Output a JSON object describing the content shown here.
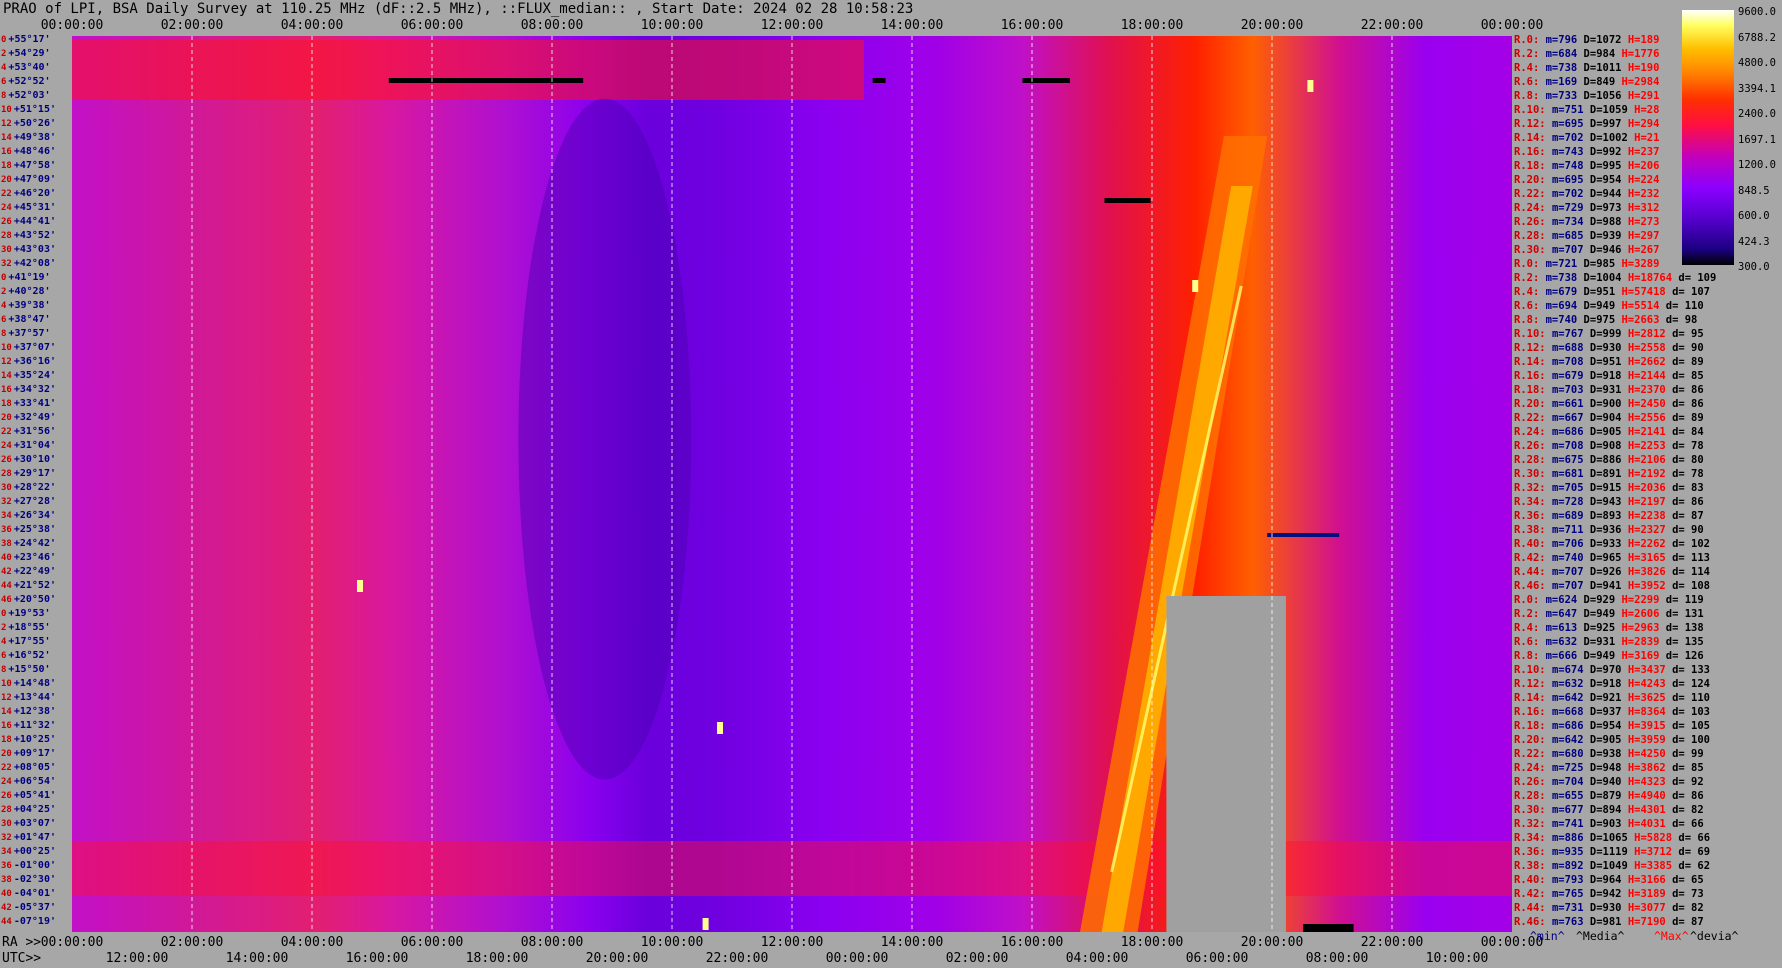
{
  "title": "PRAO of LPI, BSA Daily Survey at 110.25 MHz (dF::2.5 MHz), ::FLUX_median:: , Start Date: 2024 02 28 10:58:23",
  "chart_data": {
    "type": "heatmap",
    "title": "PRAO of LPI, BSA Daily Survey at 110.25 MHz (dF::2.5 MHz), ::FLUX_median:: , Start Date: 2024 02 28 10:58:23",
    "x_top_ticks": [
      "00:00:00",
      "02:00:00",
      "04:00:00",
      "06:00:00",
      "08:00:00",
      "10:00:00",
      "12:00:00",
      "14:00:00",
      "16:00:00",
      "18:00:00",
      "20:00:00",
      "22:00:00",
      "00:00:00"
    ],
    "x_bottom_label_ra": "RA >>",
    "x_bottom_label_utc": "UTC>>",
    "ra_ticks": [
      "00:00:00",
      "02:00:00",
      "04:00:00",
      "06:00:00",
      "08:00:00",
      "10:00:00",
      "12:00:00",
      "14:00:00",
      "16:00:00",
      "18:00:00",
      "20:00:00",
      "22:00:00",
      "00:00:00"
    ],
    "utc_ticks": [
      "12:00:00",
      "14:00:00",
      "16:00:00",
      "18:00:00",
      "20:00:00",
      "22:00:00",
      "00:00:00",
      "02:00:00",
      "04:00:00",
      "06:00:00",
      "08:00:00",
      "10:00:00"
    ],
    "y_rows": [
      {
        "n": "0",
        "dec": "+55°17'"
      },
      {
        "n": "2",
        "dec": "+54°29'"
      },
      {
        "n": "4",
        "dec": "+53°40'"
      },
      {
        "n": "6",
        "dec": "+52°52'"
      },
      {
        "n": "8",
        "dec": "+52°03'"
      },
      {
        "n": "10",
        "dec": "+51°15'"
      },
      {
        "n": "12",
        "dec": "+50°26'"
      },
      {
        "n": "14",
        "dec": "+49°38'"
      },
      {
        "n": "16",
        "dec": "+48°46'"
      },
      {
        "n": "18",
        "dec": "+47°58'"
      },
      {
        "n": "20",
        "dec": "+47°09'"
      },
      {
        "n": "22",
        "dec": "+46°20'"
      },
      {
        "n": "24",
        "dec": "+45°31'"
      },
      {
        "n": "26",
        "dec": "+44°41'"
      },
      {
        "n": "28",
        "dec": "+43°52'"
      },
      {
        "n": "30",
        "dec": "+43°03'"
      },
      {
        "n": "32",
        "dec": "+42°08'"
      },
      {
        "n": "0",
        "dec": "+41°19'"
      },
      {
        "n": "2",
        "dec": "+40°28'"
      },
      {
        "n": "4",
        "dec": "+39°38'"
      },
      {
        "n": "6",
        "dec": "+38°47'"
      },
      {
        "n": "8",
        "dec": "+37°57'"
      },
      {
        "n": "10",
        "dec": "+37°07'"
      },
      {
        "n": "12",
        "dec": "+36°16'"
      },
      {
        "n": "14",
        "dec": "+35°24'"
      },
      {
        "n": "16",
        "dec": "+34°32'"
      },
      {
        "n": "18",
        "dec": "+33°41'"
      },
      {
        "n": "20",
        "dec": "+32°49'"
      },
      {
        "n": "22",
        "dec": "+31°56'"
      },
      {
        "n": "24",
        "dec": "+31°04'"
      },
      {
        "n": "26",
        "dec": "+30°10'"
      },
      {
        "n": "28",
        "dec": "+29°17'"
      },
      {
        "n": "30",
        "dec": "+28°22'"
      },
      {
        "n": "32",
        "dec": "+27°28'"
      },
      {
        "n": "34",
        "dec": "+26°34'"
      },
      {
        "n": "36",
        "dec": "+25°38'"
      },
      {
        "n": "38",
        "dec": "+24°42'"
      },
      {
        "n": "40",
        "dec": "+23°46'"
      },
      {
        "n": "42",
        "dec": "+22°49'"
      },
      {
        "n": "44",
        "dec": "+21°52'"
      },
      {
        "n": "46",
        "dec": "+20°50'"
      },
      {
        "n": "0",
        "dec": "+19°53'"
      },
      {
        "n": "2",
        "dec": "+18°55'"
      },
      {
        "n": "4",
        "dec": "+17°55'"
      },
      {
        "n": "6",
        "dec": "+16°52'"
      },
      {
        "n": "8",
        "dec": "+15°50'"
      },
      {
        "n": "10",
        "dec": "+14°48'"
      },
      {
        "n": "12",
        "dec": "+13°44'"
      },
      {
        "n": "14",
        "dec": "+12°38'"
      },
      {
        "n": "16",
        "dec": "+11°32'"
      },
      {
        "n": "18",
        "dec": "+10°25'"
      },
      {
        "n": "20",
        "dec": "+09°17'"
      },
      {
        "n": "22",
        "dec": "+08°05'"
      },
      {
        "n": "24",
        "dec": "+06°54'"
      },
      {
        "n": "26",
        "dec": "+05°41'"
      },
      {
        "n": "28",
        "dec": "+04°25'"
      },
      {
        "n": "30",
        "dec": "+03°07'"
      },
      {
        "n": "32",
        "dec": "+01°47'"
      },
      {
        "n": "34",
        "dec": "+00°25'"
      },
      {
        "n": "36",
        "dec": "-01°00'"
      },
      {
        "n": "38",
        "dec": "-02°30'"
      },
      {
        "n": "40",
        "dec": "-04°01'"
      },
      {
        "n": "42",
        "dec": "-05°37'"
      },
      {
        "n": "44",
        "dec": "-07°19'"
      }
    ],
    "colorbar": {
      "ticks": [
        "9600.0",
        "6788.2",
        "4800.0",
        "3394.1",
        "2400.0",
        "1697.1",
        "1200.0",
        "848.5",
        "600.0",
        "424.3",
        "300.0"
      ],
      "scale": "log"
    },
    "stats": [
      {
        "r": "R.0:",
        "m": "m=796",
        "d": "D=1072",
        "h": "H=189",
        "dv": ""
      },
      {
        "r": "R.2:",
        "m": "m=684",
        "d": "D=984",
        "h": "H=1776",
        "dv": ""
      },
      {
        "r": "R.4:",
        "m": "m=738",
        "d": "D=1011",
        "h": "H=190",
        "dv": ""
      },
      {
        "r": "R.6:",
        "m": "m=169",
        "d": "D=849",
        "h": "H=2984",
        "dv": ""
      },
      {
        "r": "R.8:",
        "m": "m=733",
        "d": "D=1056",
        "h": "H=291",
        "dv": ""
      },
      {
        "r": "R.10:",
        "m": "m=751",
        "d": "D=1059",
        "h": "H=28",
        "dv": ""
      },
      {
        "r": "R.12:",
        "m": "m=695",
        "d": "D=997",
        "h": "H=294",
        "dv": ""
      },
      {
        "r": "R.14:",
        "m": "m=702",
        "d": "D=1002",
        "h": "H=21",
        "dv": ""
      },
      {
        "r": "R.16:",
        "m": "m=743",
        "d": "D=992",
        "h": "H=237",
        "dv": ""
      },
      {
        "r": "R.18:",
        "m": "m=748",
        "d": "D=995",
        "h": "H=206",
        "dv": ""
      },
      {
        "r": "R.20:",
        "m": "m=695",
        "d": "D=954",
        "h": "H=224",
        "dv": ""
      },
      {
        "r": "R.22:",
        "m": "m=702",
        "d": "D=944",
        "h": "H=232",
        "dv": ""
      },
      {
        "r": "R.24:",
        "m": "m=729",
        "d": "D=973",
        "h": "H=312",
        "dv": ""
      },
      {
        "r": "R.26:",
        "m": "m=734",
        "d": "D=988",
        "h": "H=273",
        "dv": ""
      },
      {
        "r": "R.28:",
        "m": "m=685",
        "d": "D=939",
        "h": "H=297",
        "dv": ""
      },
      {
        "r": "R.30:",
        "m": "m=707",
        "d": "D=946",
        "h": "H=267",
        "dv": ""
      },
      {
        "r": "R.0:",
        "m": "m=721",
        "d": "D=985",
        "h": "H=3289",
        "dv": ""
      },
      {
        "r": "R.2:",
        "m": "m=738",
        "d": "D=1004",
        "h": "H=18764",
        "dv": "d= 109"
      },
      {
        "r": "R.4:",
        "m": "m=679",
        "d": "D=951",
        "h": "H=57418",
        "dv": "d= 107"
      },
      {
        "r": "R.6:",
        "m": "m=694",
        "d": "D=949",
        "h": "H=5514",
        "dv": "d= 110"
      },
      {
        "r": "R.8:",
        "m": "m=740",
        "d": "D=975",
        "h": "H=2663",
        "dv": "d= 98"
      },
      {
        "r": "R.10:",
        "m": "m=767",
        "d": "D=999",
        "h": "H=2812",
        "dv": "d= 95"
      },
      {
        "r": "R.12:",
        "m": "m=688",
        "d": "D=930",
        "h": "H=2558",
        "dv": "d= 90"
      },
      {
        "r": "R.14:",
        "m": "m=708",
        "d": "D=951",
        "h": "H=2662",
        "dv": "d= 89"
      },
      {
        "r": "R.16:",
        "m": "m=679",
        "d": "D=918",
        "h": "H=2144",
        "dv": "d= 85"
      },
      {
        "r": "R.18:",
        "m": "m=703",
        "d": "D=931",
        "h": "H=2370",
        "dv": "d= 86"
      },
      {
        "r": "R.20:",
        "m": "m=661",
        "d": "D=900",
        "h": "H=2450",
        "dv": "d= 86"
      },
      {
        "r": "R.22:",
        "m": "m=667",
        "d": "D=904",
        "h": "H=2556",
        "dv": "d= 89"
      },
      {
        "r": "R.24:",
        "m": "m=686",
        "d": "D=905",
        "h": "H=2141",
        "dv": "d= 84"
      },
      {
        "r": "R.26:",
        "m": "m=708",
        "d": "D=908",
        "h": "H=2253",
        "dv": "d= 78"
      },
      {
        "r": "R.28:",
        "m": "m=675",
        "d": "D=886",
        "h": "H=2106",
        "dv": "d= 80"
      },
      {
        "r": "R.30:",
        "m": "m=681",
        "d": "D=891",
        "h": "H=2192",
        "dv": "d= 78"
      },
      {
        "r": "R.32:",
        "m": "m=705",
        "d": "D=915",
        "h": "H=2036",
        "dv": "d= 83"
      },
      {
        "r": "R.34:",
        "m": "m=728",
        "d": "D=943",
        "h": "H=2197",
        "dv": "d= 86"
      },
      {
        "r": "R.36:",
        "m": "m=689",
        "d": "D=893",
        "h": "H=2238",
        "dv": "d= 87"
      },
      {
        "r": "R.38:",
        "m": "m=711",
        "d": "D=936",
        "h": "H=2327",
        "dv": "d= 90"
      },
      {
        "r": "R.40:",
        "m": "m=706",
        "d": "D=933",
        "h": "H=2262",
        "dv": "d= 102"
      },
      {
        "r": "R.42:",
        "m": "m=740",
        "d": "D=965",
        "h": "H=3165",
        "dv": "d= 113"
      },
      {
        "r": "R.44:",
        "m": "m=707",
        "d": "D=926",
        "h": "H=3826",
        "dv": "d= 114"
      },
      {
        "r": "R.46:",
        "m": "m=707",
        "d": "D=941",
        "h": "H=3952",
        "dv": "d= 108"
      },
      {
        "r": "R.0:",
        "m": "m=624",
        "d": "D=929",
        "h": "H=2299",
        "dv": "d= 119"
      },
      {
        "r": "R.2:",
        "m": "m=647",
        "d": "D=949",
        "h": "H=2606",
        "dv": "d= 131"
      },
      {
        "r": "R.4:",
        "m": "m=613",
        "d": "D=925",
        "h": "H=2963",
        "dv": "d= 138"
      },
      {
        "r": "R.6:",
        "m": "m=632",
        "d": "D=931",
        "h": "H=2839",
        "dv": "d= 135"
      },
      {
        "r": "R.8:",
        "m": "m=666",
        "d": "D=949",
        "h": "H=3169",
        "dv": "d= 126"
      },
      {
        "r": "R.10:",
        "m": "m=674",
        "d": "D=970",
        "h": "H=3437",
        "dv": "d= 133"
      },
      {
        "r": "R.12:",
        "m": "m=632",
        "d": "D=918",
        "h": "H=4243",
        "dv": "d= 124"
      },
      {
        "r": "R.14:",
        "m": "m=642",
        "d": "D=921",
        "h": "H=3625",
        "dv": "d= 110"
      },
      {
        "r": "R.16:",
        "m": "m=668",
        "d": "D=937",
        "h": "H=8364",
        "dv": "d= 103"
      },
      {
        "r": "R.18:",
        "m": "m=686",
        "d": "D=954",
        "h": "H=3915",
        "dv": "d= 105"
      },
      {
        "r": "R.20:",
        "m": "m=642",
        "d": "D=905",
        "h": "H=3959",
        "dv": "d= 100"
      },
      {
        "r": "R.22:",
        "m": "m=680",
        "d": "D=938",
        "h": "H=4250",
        "dv": "d= 99"
      },
      {
        "r": "R.24:",
        "m": "m=725",
        "d": "D=948",
        "h": "H=3862",
        "dv": "d= 85"
      },
      {
        "r": "R.26:",
        "m": "m=704",
        "d": "D=940",
        "h": "H=4323",
        "dv": "d= 92"
      },
      {
        "r": "R.28:",
        "m": "m=655",
        "d": "D=879",
        "h": "H=4940",
        "dv": "d= 86"
      },
      {
        "r": "R.30:",
        "m": "m=677",
        "d": "D=894",
        "h": "H=4301",
        "dv": "d= 82"
      },
      {
        "r": "R.32:",
        "m": "m=741",
        "d": "D=903",
        "h": "H=4031",
        "dv": "d= 66"
      },
      {
        "r": "R.34:",
        "m": "m=886",
        "d": "D=1065",
        "h": "H=5828",
        "dv": "d= 66"
      },
      {
        "r": "R.36:",
        "m": "m=935",
        "d": "D=1119",
        "h": "H=3712",
        "dv": "d= 69"
      },
      {
        "r": "R.38:",
        "m": "m=892",
        "d": "D=1049",
        "h": "H=3385",
        "dv": "d= 62"
      },
      {
        "r": "R.40:",
        "m": "m=793",
        "d": "D=964",
        "h": "H=3166",
        "dv": "d= 65"
      },
      {
        "r": "R.42:",
        "m": "m=765",
        "d": "D=942",
        "h": "H=3189",
        "dv": "d= 73"
      },
      {
        "r": "R.44:",
        "m": "m=731",
        "d": "D=930",
        "h": "H=3077",
        "dv": "d= 82"
      },
      {
        "r": "R.46:",
        "m": "m=763",
        "d": "D=981",
        "h": "H=7190",
        "dv": "d= 87"
      }
    ],
    "legend": {
      "min": "^min^",
      "median": "^Media^",
      "max": "^Max^",
      "devia": "^devia^"
    },
    "colors": {
      "background": "#a7a7a7",
      "low": "#5a00d8",
      "mid": "#9000f0",
      "high": "#ff2020",
      "peak": "#ffff80"
    }
  }
}
